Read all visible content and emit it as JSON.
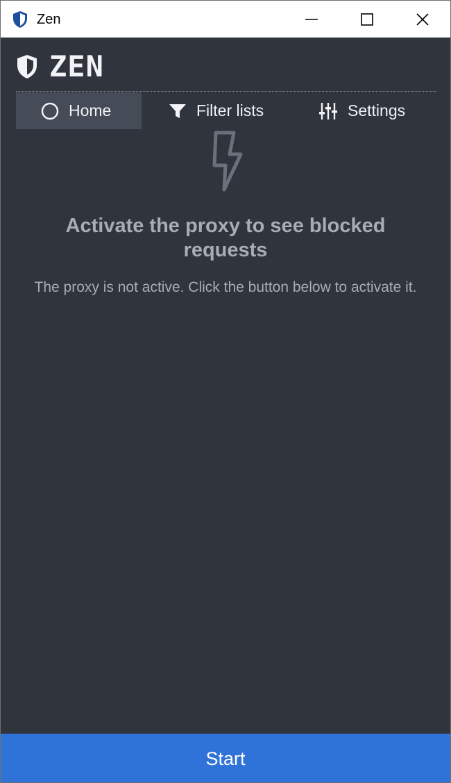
{
  "window": {
    "title": "Zen",
    "app_icon": "shield-icon",
    "controls": {
      "minimize_icon": "minimize-icon",
      "maximize_icon": "maximize-icon",
      "close_icon": "close-icon"
    }
  },
  "header": {
    "brand_name": "ZEN",
    "logo_icon": "shield-icon"
  },
  "tabs": [
    {
      "label": "Home",
      "icon": "circle-icon",
      "active": true
    },
    {
      "label": "Filter lists",
      "icon": "filter-icon",
      "active": false
    },
    {
      "label": "Settings",
      "icon": "sliders-icon",
      "active": false
    }
  ],
  "main": {
    "empty_state_icon": "lightning-icon",
    "title": "Activate the proxy to see blocked requests",
    "description": "The proxy is not active. Click the button below to activate it."
  },
  "footer": {
    "start_label": "Start"
  },
  "colors": {
    "background": "#2f343d",
    "tab_active": "#464c57",
    "accent": "#2f73d8",
    "muted_text": "#a8adb5",
    "titlebar_icon": "#1f4f9e"
  }
}
